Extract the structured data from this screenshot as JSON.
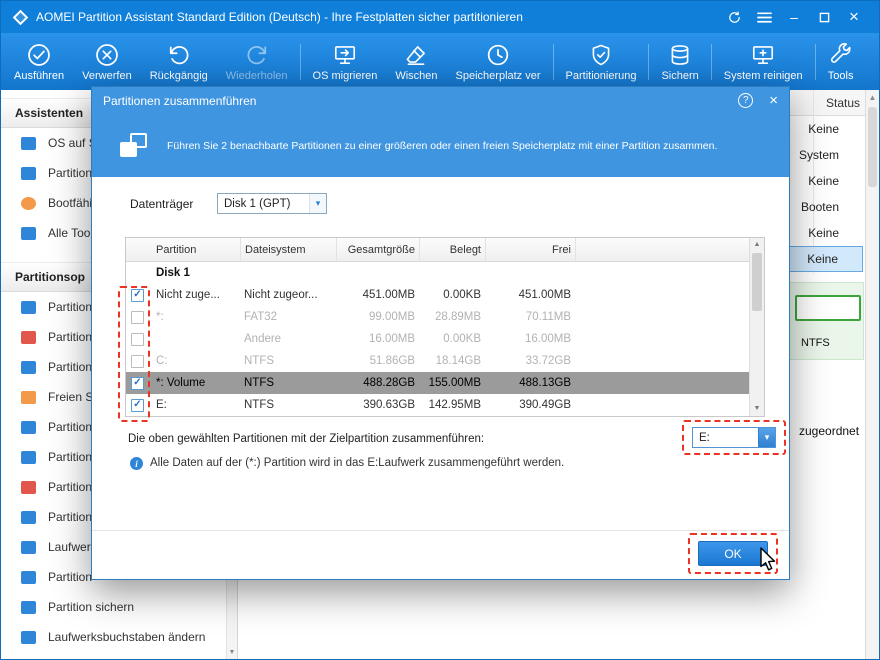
{
  "window": {
    "title": "AOMEI Partition Assistant Standard Edition (Deutsch) - Ihre Festplatten sicher partitionieren"
  },
  "glyphs": {
    "close": "×",
    "minimize": "–",
    "help": "?",
    "dropdown": "▾",
    "up": "▲",
    "down": "▼",
    "check": "✓",
    "info": "i"
  },
  "toolbar": {
    "items": [
      {
        "label": "Ausführen"
      },
      {
        "label": "Verwerfen"
      },
      {
        "label": "Rückgängig"
      },
      {
        "label": "Wiederholen"
      },
      {
        "label": "OS migrieren"
      },
      {
        "label": "Wischen"
      },
      {
        "label": "Speicherplatz ver"
      },
      {
        "label": "Partitionierung"
      },
      {
        "label": "Sichern"
      },
      {
        "label": "System reinigen"
      },
      {
        "label": "Tools"
      }
    ]
  },
  "sidebar": {
    "sections": [
      {
        "title": "Assistenten",
        "items": [
          {
            "label": "OS auf S"
          },
          {
            "label": "Partition"
          },
          {
            "label": "Bootfähi"
          },
          {
            "label": "Alle Tool"
          }
        ]
      },
      {
        "title": "Partitionsop",
        "items": [
          {
            "label": "Partition"
          },
          {
            "label": "Partition"
          },
          {
            "label": "Partition"
          },
          {
            "label": "Freien Sp"
          },
          {
            "label": "Partition"
          },
          {
            "label": "Partition"
          },
          {
            "label": "Partition"
          },
          {
            "label": "Partition"
          },
          {
            "label": "Laufwerk"
          },
          {
            "label": "Partition"
          },
          {
            "label": "Partition sichern"
          },
          {
            "label": "Laufwerksbuchstaben ändern"
          }
        ]
      }
    ]
  },
  "main_panel": {
    "status_header": "Status",
    "status_rows": [
      "Keine",
      "System",
      "Keine",
      "Booten",
      "Keine",
      "Keine"
    ],
    "fs_label": "NTFS",
    "partial_label": "zugeordnet"
  },
  "dialog": {
    "title": "Partitionen zusammenführen",
    "description": "Führen Sie 2 benachbarte Partitionen zu einer größeren oder einen freien Speicherplatz mit einer Partition zusammen.",
    "disk_label": "Datenträger",
    "disk_value": "Disk 1 (GPT)",
    "table": {
      "headers": [
        "Partition",
        "Dateisystem",
        "Gesamtgröße",
        "Belegt",
        "Frei"
      ],
      "group_label": "Disk 1",
      "rows": [
        {
          "checked": true,
          "partition": "Nicht zuge...",
          "filesystem": "Nicht zugeor...",
          "total": "451.00MB",
          "used": "0.00KB",
          "free": "451.00MB"
        },
        {
          "checked": false,
          "partition": "*:",
          "filesystem": "FAT32",
          "total": "99.00MB",
          "used": "28.89MB",
          "free": "70.11MB"
        },
        {
          "checked": false,
          "partition": "",
          "filesystem": "Andere",
          "total": "16.00MB",
          "used": "0.00KB",
          "free": "16.00MB"
        },
        {
          "checked": false,
          "partition": "C:",
          "filesystem": "NTFS",
          "total": "51.86GB",
          "used": "18.14GB",
          "free": "33.72GB"
        },
        {
          "checked": true,
          "partition": "*: Volume",
          "filesystem": "NTFS",
          "total": "488.28GB",
          "used": "155.00MB",
          "free": "488.13GB"
        },
        {
          "checked": true,
          "partition": "E:",
          "filesystem": "NTFS",
          "total": "390.63GB",
          "used": "142.95MB",
          "free": "390.49GB"
        }
      ]
    },
    "target_label": "Die oben gewählten Partitionen mit der Zielpartition zusammenführen:",
    "target_value": "E:",
    "info_text": "Alle Daten auf der (*:) Partition wird in das E:Laufwerk zusammengeführt werden.",
    "ok_label": "OK"
  },
  "colors": {
    "titlebar_blue": "#0f7fd9",
    "dialog_blue": "#3f95e0",
    "annotation_red": "#ea3323",
    "ok_button_blue": "#1b78d2",
    "selected_row_gray": "#9b9b9b",
    "selection_blue": "#d2e8fb",
    "partition_green": "#3ca43c"
  }
}
